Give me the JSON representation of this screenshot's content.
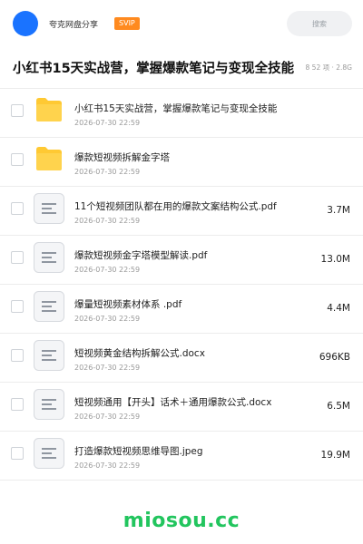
{
  "header": {
    "app_name": "夸克网盘分享",
    "badge": "SVIP",
    "search_placeholder": "搜索"
  },
  "title": {
    "text": "小红书15天实战营，掌握爆款笔记与变现全技能",
    "meta": "8 52 项 · 2.8G"
  },
  "files": [
    {
      "type": "folder",
      "name": "小红书15天实战营，掌握爆款笔记与变现全技能",
      "date": "2026-07-30 22:59",
      "size": ""
    },
    {
      "type": "folder",
      "name": "爆款短视频拆解金字塔",
      "date": "2026-07-30 22:59",
      "size": ""
    },
    {
      "type": "file",
      "name": "11个短视频团队都在用的爆款文案结构公式.pdf",
      "date": "2026-07-30 22:59",
      "size": "3.7M"
    },
    {
      "type": "file",
      "name": "爆款短视频金字塔模型解读.pdf",
      "date": "2026-07-30 22:59",
      "size": "13.0M"
    },
    {
      "type": "file",
      "name": "爆量短视频素材体系 .pdf",
      "date": "2026-07-30 22:59",
      "size": "4.4M"
    },
    {
      "type": "file",
      "name": "短视频黄金结构拆解公式.docx",
      "date": "2026-07-30 22:59",
      "size": "696KB"
    },
    {
      "type": "file",
      "name": "短视频通用【开头】话术＋通用爆款公式.docx",
      "date": "2026-07-30 22:59",
      "size": "6.5M"
    },
    {
      "type": "file",
      "name": "打造爆款短视频思维导图.jpeg",
      "date": "2026-07-30 22:59",
      "size": "19.9M"
    }
  ],
  "watermark": "miosou.cc",
  "colors": {
    "accent": "#1a73ff",
    "svip": "#ff8a1f",
    "folder": "#ffc933",
    "watermark": "#22c55e"
  }
}
